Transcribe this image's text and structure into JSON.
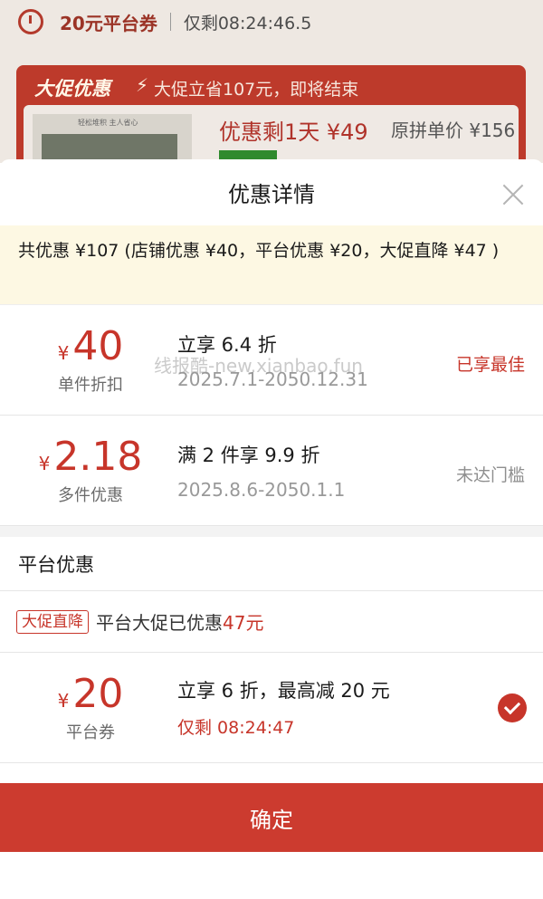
{
  "background": {
    "coupon_label": "20元平台券",
    "remain_label": "仅剩08:24:46.5",
    "banner_title": "大促优惠",
    "banner_sub": "大促立省107元，即将结束",
    "thumb_text": "轻松堆积 主人省心",
    "deal_text": "优惠剩1天 ¥49",
    "orig_price": "原拼单价 ¥156"
  },
  "modal": {
    "title": "优惠详情",
    "summary": "共优惠 ¥107 (店铺优惠 ¥40，平台优惠 ¥20，大促直降 ¥47 )",
    "watermark": "线报酷-new.xianbao.fun"
  },
  "store_offers": [
    {
      "yen": "¥",
      "amount": "40",
      "label": "单件折扣",
      "desc": "立享 6.4 折",
      "period": "2025.7.1-2050.12.31",
      "state": "已享最佳"
    },
    {
      "yen": "¥",
      "amount": "2.18",
      "label": "多件优惠",
      "desc": "满 2 件享 9.9 折",
      "period": "2025.8.6-2050.1.1",
      "state": "未达门槛"
    }
  ],
  "platform": {
    "section_title": "平台优惠",
    "promo_tag": "大促直降",
    "promo_text": "平台大促已优惠",
    "promo_amount": "47元",
    "coupon": {
      "yen": "¥",
      "amount": "20",
      "label": "平台券",
      "desc": "立享 6 折，最高减 20 元",
      "time": "仅剩 08:24:47"
    }
  },
  "confirm_label": "确定",
  "colors": {
    "accent": "#c7352a",
    "summary_bg": "#fdf8e3",
    "confirm_bg": "#cc3b2f"
  },
  "icons": [
    "alarm-clock-icon",
    "lightning-icon",
    "close-icon",
    "checkmark-icon"
  ]
}
